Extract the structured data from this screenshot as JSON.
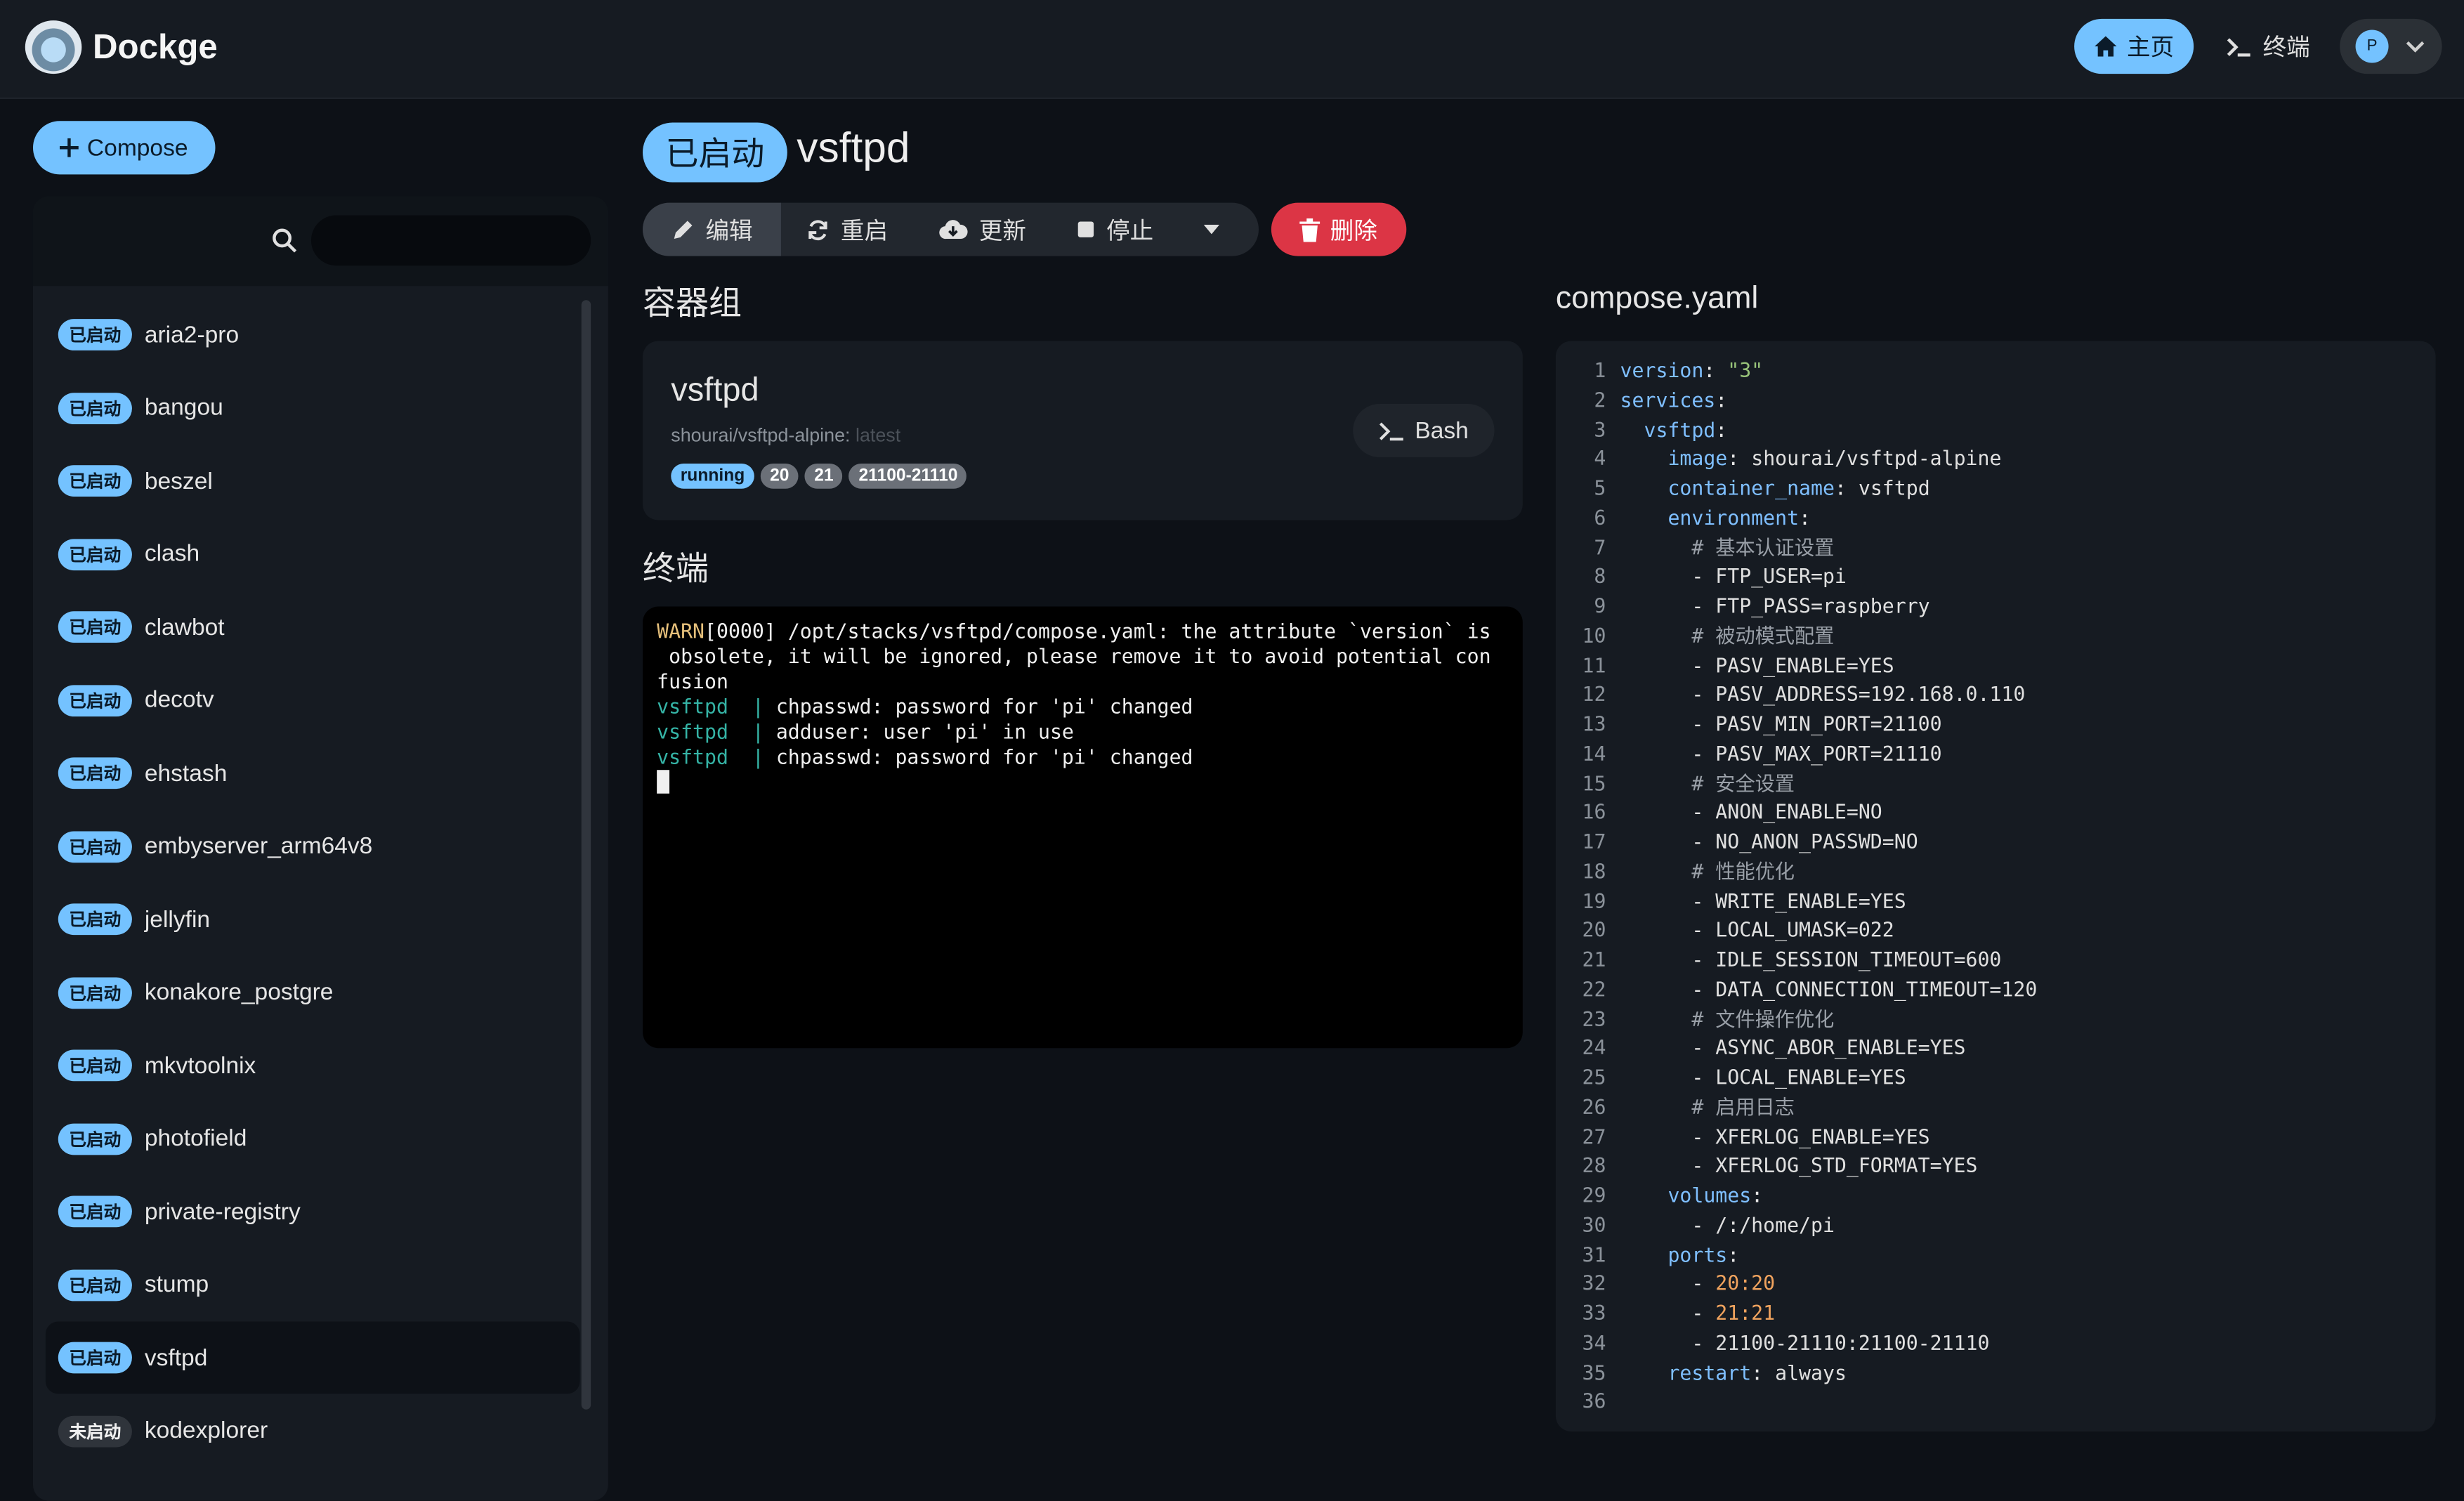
{
  "header": {
    "brand": "Dockge",
    "home_label": "主页",
    "terminal_label": "终端",
    "avatar_initial": "P"
  },
  "sidebar": {
    "compose_label": "Compose",
    "search_placeholder": "",
    "stacks": [
      {
        "status": "已启动",
        "name": "aria2-pro",
        "running": true
      },
      {
        "status": "已启动",
        "name": "bangou",
        "running": true
      },
      {
        "status": "已启动",
        "name": "beszel",
        "running": true
      },
      {
        "status": "已启动",
        "name": "clash",
        "running": true
      },
      {
        "status": "已启动",
        "name": "clawbot",
        "running": true
      },
      {
        "status": "已启动",
        "name": "decotv",
        "running": true
      },
      {
        "status": "已启动",
        "name": "ehstash",
        "running": true
      },
      {
        "status": "已启动",
        "name": "embyserver_arm64v8",
        "running": true
      },
      {
        "status": "已启动",
        "name": "jellyfin",
        "running": true
      },
      {
        "status": "已启动",
        "name": "konakore_postgre",
        "running": true
      },
      {
        "status": "已启动",
        "name": "mkvtoolnix",
        "running": true
      },
      {
        "status": "已启动",
        "name": "photofield",
        "running": true
      },
      {
        "status": "已启动",
        "name": "private-registry",
        "running": true
      },
      {
        "status": "已启动",
        "name": "stump",
        "running": true
      },
      {
        "status": "已启动",
        "name": "vsftpd",
        "running": true,
        "active": true
      },
      {
        "status": "未启动",
        "name": "kodexplorer",
        "running": false
      }
    ]
  },
  "stack": {
    "status": "已启动",
    "name": "vsftpd",
    "actions": {
      "edit": "编辑",
      "restart": "重启",
      "update": "更新",
      "stop": "停止",
      "delete": "删除"
    }
  },
  "containers": {
    "heading": "容器组",
    "items": [
      {
        "name": "vsftpd",
        "image": "shourai/vsftpd-alpine:",
        "tag": "latest",
        "state": "running",
        "ports": [
          "20",
          "21",
          "21100-21110"
        ],
        "bash_label": "Bash"
      }
    ]
  },
  "terminal": {
    "heading": "终端",
    "lines": [
      {
        "type": "warn",
        "prefix": "WARN",
        "text": "[0000] /opt/stacks/vsftpd/compose.yaml: the attribute `version` is\n obsolete, it will be ignored, please remove it to avoid potential con\nfusion"
      },
      {
        "type": "svc",
        "service": "vsftpd",
        "text": "chpasswd: password for 'pi' changed"
      },
      {
        "type": "svc",
        "service": "vsftpd",
        "text": "adduser: user 'pi' in use"
      },
      {
        "type": "svc",
        "service": "vsftpd",
        "text": "chpasswd: password for 'pi' changed"
      }
    ]
  },
  "editor": {
    "heading": "compose.yaml",
    "lines": [
      "version: \"3\"",
      "services:",
      "  vsftpd:",
      "    image: shourai/vsftpd-alpine",
      "    container_name: vsftpd",
      "    environment:",
      "      # 基本认证设置",
      "      - FTP_USER=pi",
      "      - FTP_PASS=raspberry",
      "      # 被动模式配置",
      "      - PASV_ENABLE=YES",
      "      - PASV_ADDRESS=192.168.0.110",
      "      - PASV_MIN_PORT=21100",
      "      - PASV_MAX_PORT=21110",
      "      # 安全设置",
      "      - ANON_ENABLE=NO",
      "      - NO_ANON_PASSWD=NO",
      "      # 性能优化",
      "      - WRITE_ENABLE=YES",
      "      - LOCAL_UMASK=022",
      "      - IDLE_SESSION_TIMEOUT=600",
      "      - DATA_CONNECTION_TIMEOUT=120",
      "      # 文件操作优化",
      "      - ASYNC_ABOR_ENABLE=YES",
      "      - LOCAL_ENABLE=YES",
      "      # 启用日志",
      "      - XFERLOG_ENABLE=YES",
      "      - XFERLOG_STD_FORMAT=YES",
      "    volumes:",
      "      - /:/home/pi",
      "    ports:",
      "      - 20:20",
      "      - 21:21",
      "      - 21100-21110:21100-21110",
      "    restart: always",
      ""
    ]
  },
  "colors": {
    "accent": "#74c2ff",
    "danger": "#dc3545",
    "background": "#0d1117",
    "panel": "#161b22"
  }
}
